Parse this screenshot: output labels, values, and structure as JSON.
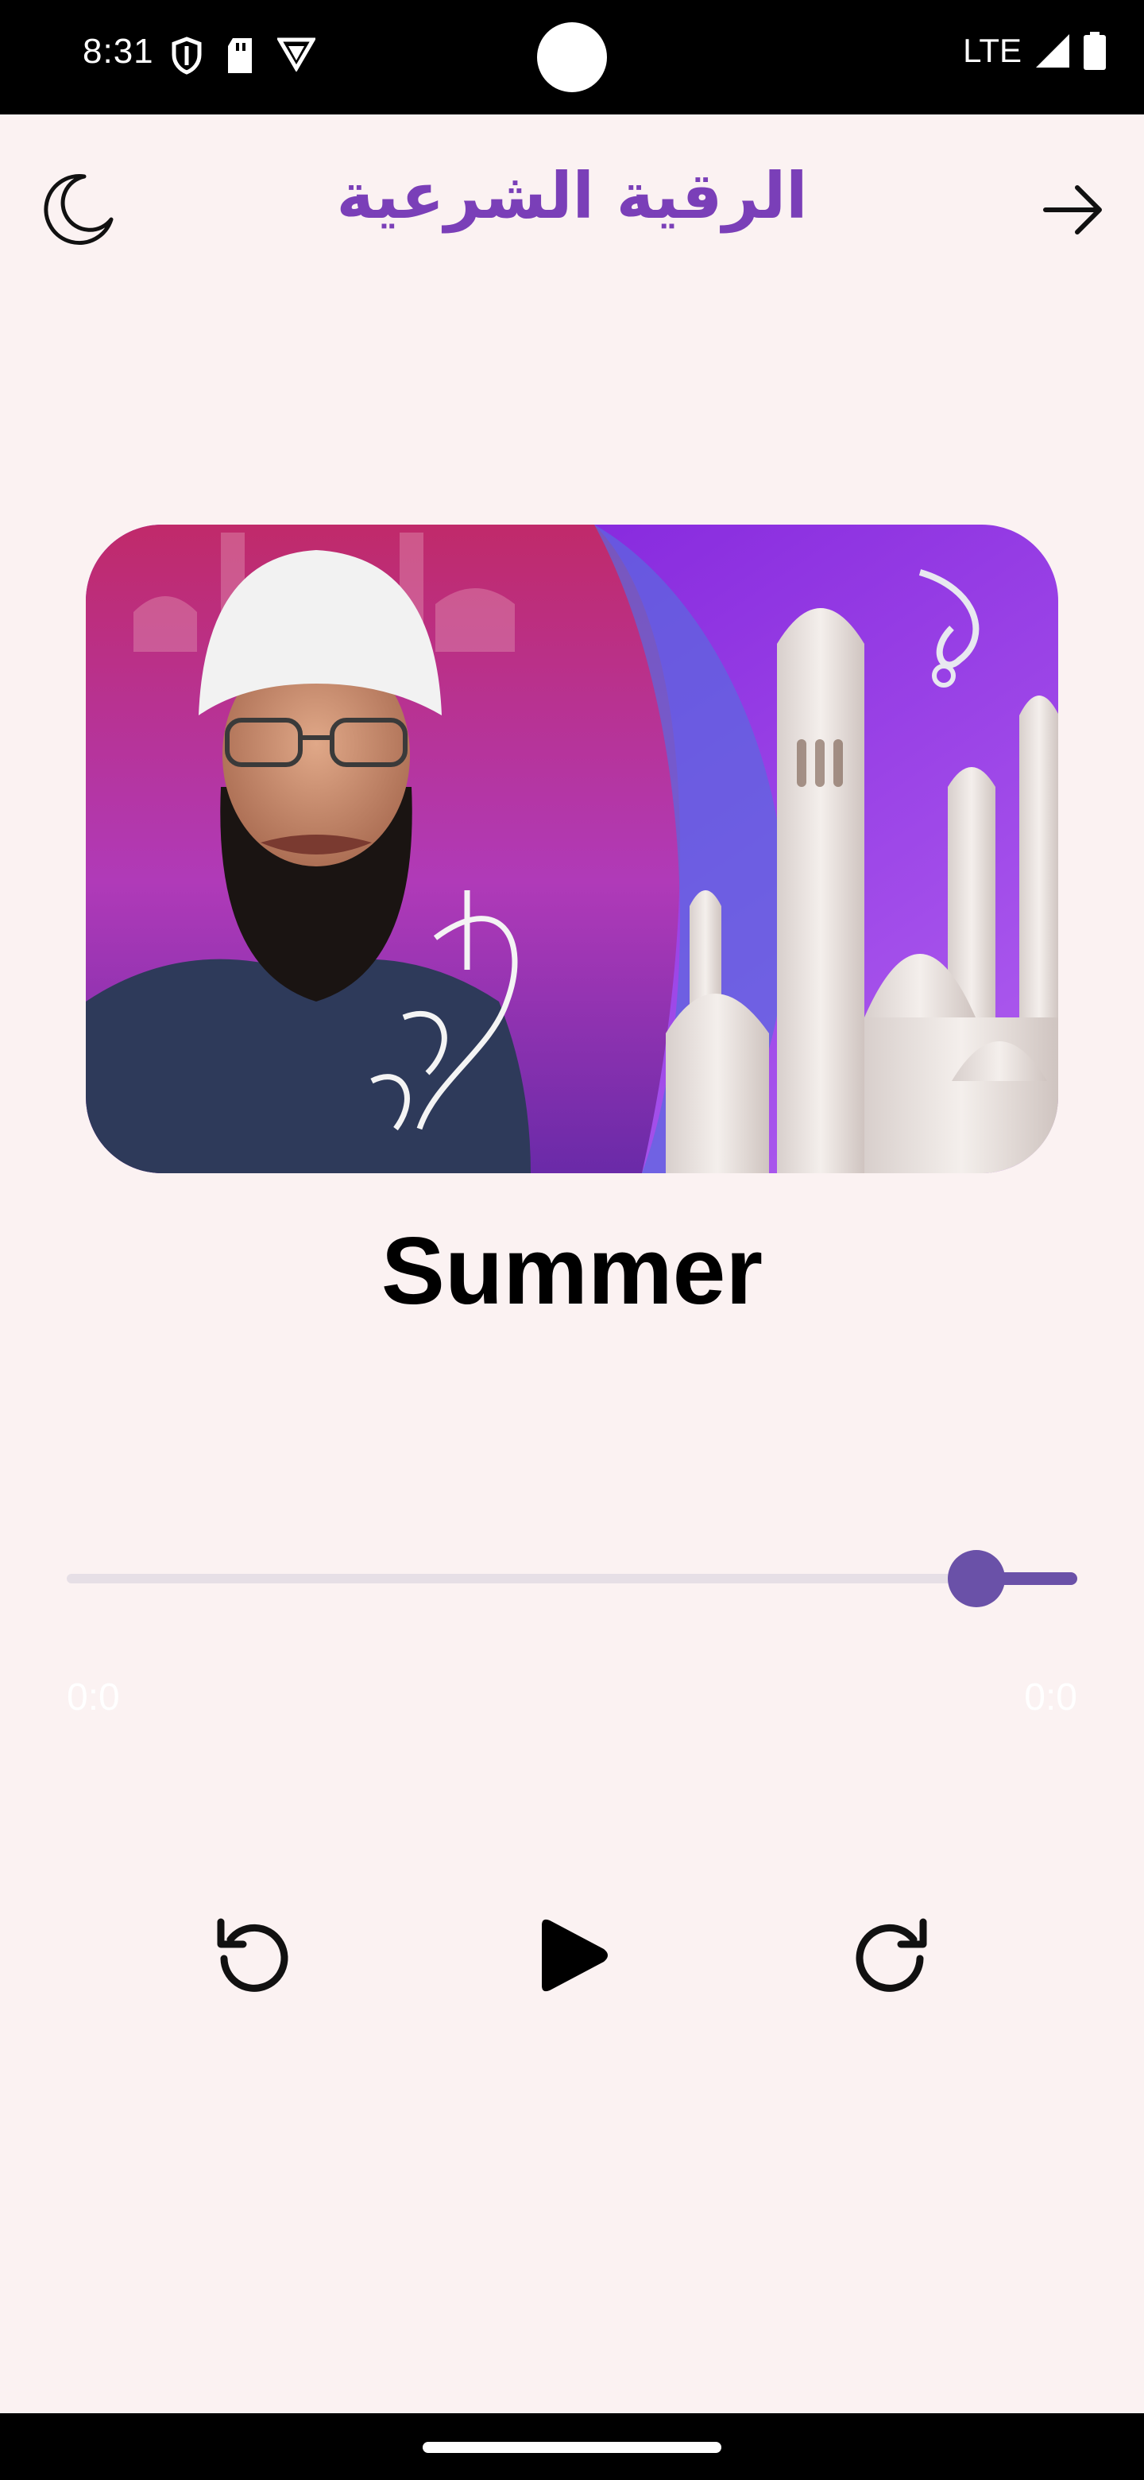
{
  "status_bar": {
    "time": "8:31",
    "network": "LTE",
    "icons": [
      "shield-icon",
      "sd-card-icon",
      "vpn-icon",
      "signal-icon",
      "battery-icon"
    ]
  },
  "app_bar": {
    "title": "الرقية الشرعية",
    "left_icon": "moon-icon",
    "right_icon": "arrow-forward-icon"
  },
  "player": {
    "artwork_icon": "album-artwork",
    "track_title": "Summer",
    "progress_fraction": 0.9,
    "elapsed": "0:0",
    "duration": "0:0",
    "controls": [
      "replay-icon",
      "play-icon",
      "forward-icon"
    ]
  },
  "colors": {
    "background": "#fbf2f2",
    "accent": "#6a51a8",
    "title": "#7a3fb8"
  }
}
